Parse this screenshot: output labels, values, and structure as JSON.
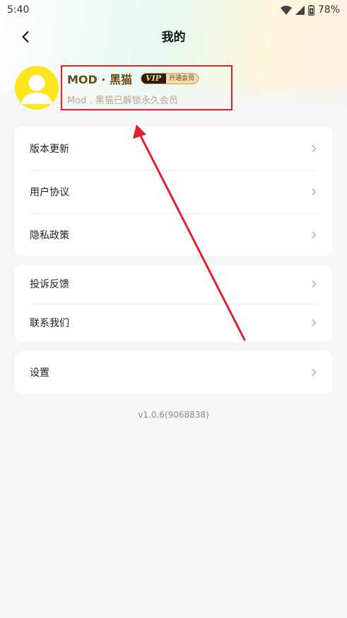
{
  "status_bar": {
    "time": "5:40",
    "battery": "78%"
  },
  "header": {
    "title": "我的",
    "back_icon": "chevron-left-icon"
  },
  "profile": {
    "name": "MOD · 黑猫",
    "vip_tag": "VIP",
    "vip_action": "开通会员",
    "description": "Mod . 黑猫已解锁永久会员"
  },
  "menu_groups": [
    {
      "items": [
        {
          "label": "版本更新"
        },
        {
          "label": "用户协议"
        },
        {
          "label": "隐私政策"
        }
      ]
    },
    {
      "items": [
        {
          "label": "投诉反馈"
        },
        {
          "label": "联系我们"
        }
      ]
    },
    {
      "items": [
        {
          "label": "设置"
        }
      ]
    }
  ],
  "version": "v1.0.6(9068838)",
  "colors": {
    "highlight_box": "#e0202b",
    "avatar_bg": "#ffe51f",
    "user_name": "#6b4a1c",
    "page_bg": "#f6f6f6"
  }
}
